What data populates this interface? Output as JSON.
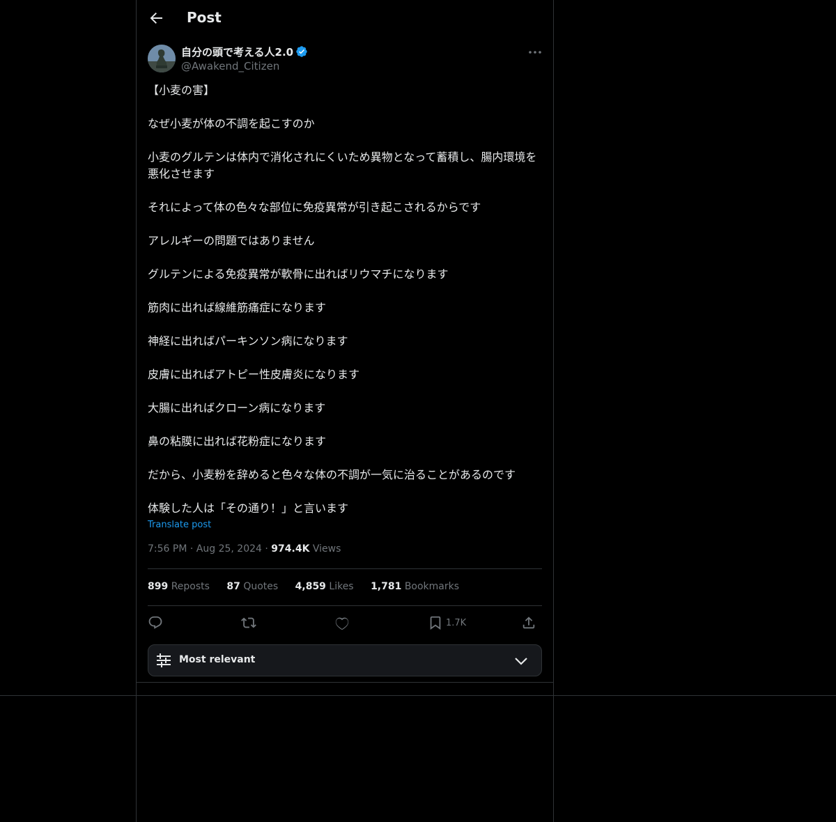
{
  "header": {
    "title": "Post"
  },
  "author": {
    "display_name": "自分の頭で考える人2.0",
    "handle": "@Awakend_Citizen",
    "verified": true
  },
  "post": {
    "paragraphs": [
      "【小麦の害】",
      "なぜ小麦が体の不調を起こすのか",
      "小麦のグルテンは体内で消化されにくいため異物となって蓄積し、腸内環境を悪化させます",
      "それによって体の色々な部位に免疫異常が引き起こされるからです",
      "アレルギーの問題ではありません",
      "グルテンによる免疫異常が軟骨に出ればリウマチになります",
      "筋肉に出れば線維筋痛症になります",
      "神経に出ればパーキンソン病になります",
      "皮膚に出ればアトピー性皮膚炎になります",
      "大腸に出ればクローン病になります",
      "鼻の粘膜に出れば花粉症になります",
      "だから、小麦粉を辞めると色々な体の不調が一気に治ることがあるのです",
      "体験した人は「その通り！」と言います"
    ],
    "translate_label": "Translate post",
    "time": "7:56 PM",
    "date": "Aug 25, 2024",
    "views_count": "974.4K",
    "views_label": "Views"
  },
  "stats": {
    "reposts_count": "899",
    "reposts_label": "Reposts",
    "quotes_count": "87",
    "quotes_label": "Quotes",
    "likes_count": "4,859",
    "likes_label": "Likes",
    "bookmarks_count": "1,781",
    "bookmarks_label": "Bookmarks"
  },
  "actions": {
    "reply_icon": "reply-icon",
    "repost_icon": "repost-icon",
    "like_icon": "heart-icon",
    "bookmark_icon": "bookmark-icon",
    "bookmark_count": "1.7K",
    "share_icon": "share-icon"
  },
  "sort": {
    "label": "Most relevant"
  },
  "colors": {
    "background": "#000000",
    "text": "#e7e9ea",
    "muted": "#71767b",
    "accent": "#1d9bf0",
    "border": "#2f3336"
  }
}
